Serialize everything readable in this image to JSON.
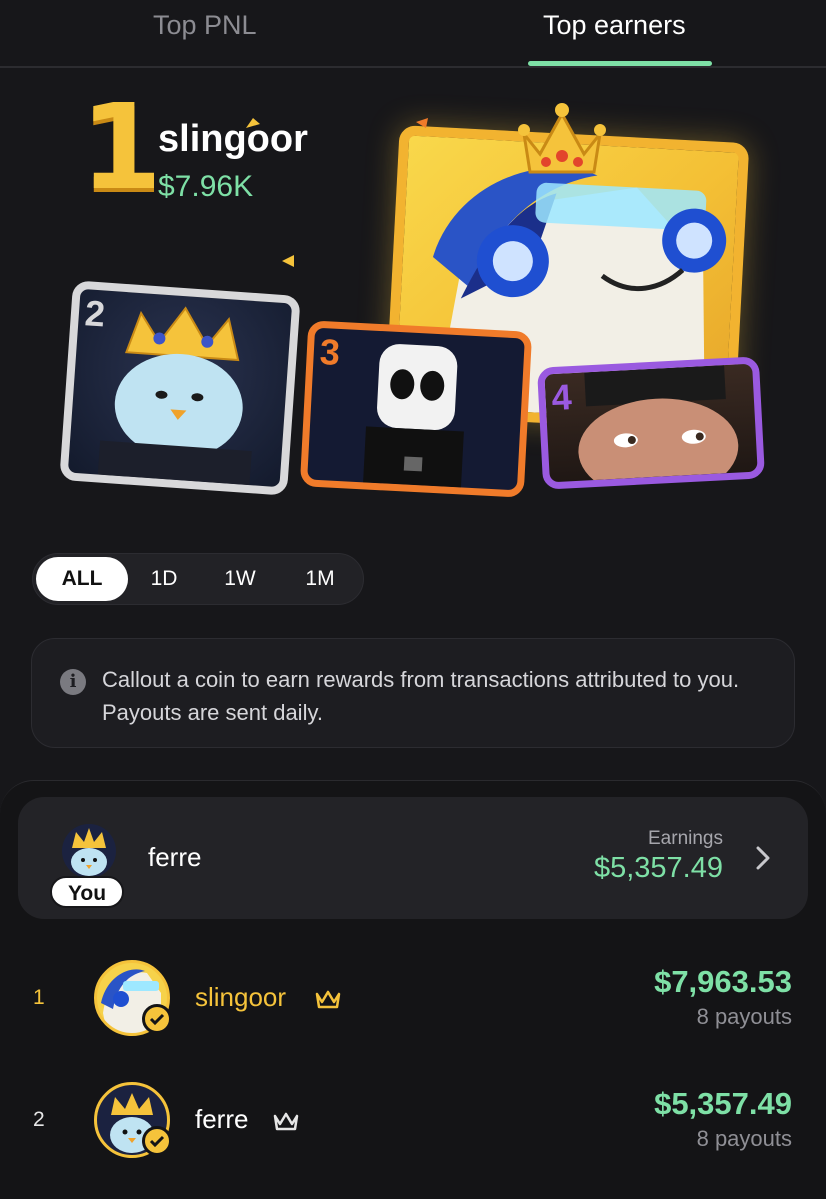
{
  "tabs": [
    {
      "label": "Top PNL",
      "active": false
    },
    {
      "label": "Top earners",
      "active": true
    }
  ],
  "hero": {
    "rank": "1",
    "name": "slingoor",
    "amount": "$7.96K",
    "cards": [
      {
        "rank": "2",
        "color": "#d8d8da"
      },
      {
        "rank": "3",
        "color": "#f07b2a"
      },
      {
        "rank": "4",
        "color": "#9a5ae0"
      }
    ]
  },
  "filters": {
    "options": [
      "ALL",
      "1D",
      "1W",
      "1M"
    ],
    "selected": "ALL"
  },
  "info": {
    "icon": "info-icon",
    "text": "Callout a coin to earn rewards from transactions attributed to you. Payouts are sent daily."
  },
  "me": {
    "name": "ferre",
    "badge": "You",
    "earnings_label": "Earnings",
    "earnings_value": "$5,357.49"
  },
  "leaderboard": [
    {
      "rank": "1",
      "name": "slingoor",
      "value": "$7,963.53",
      "payouts": "8 payouts",
      "highlight": true
    },
    {
      "rank": "2",
      "name": "ferre",
      "value": "$5,357.49",
      "payouts": "8 payouts",
      "highlight": false
    }
  ],
  "colors": {
    "accent_green": "#7ee0a6",
    "gold": "#f5c33b",
    "background": "#17171a"
  }
}
